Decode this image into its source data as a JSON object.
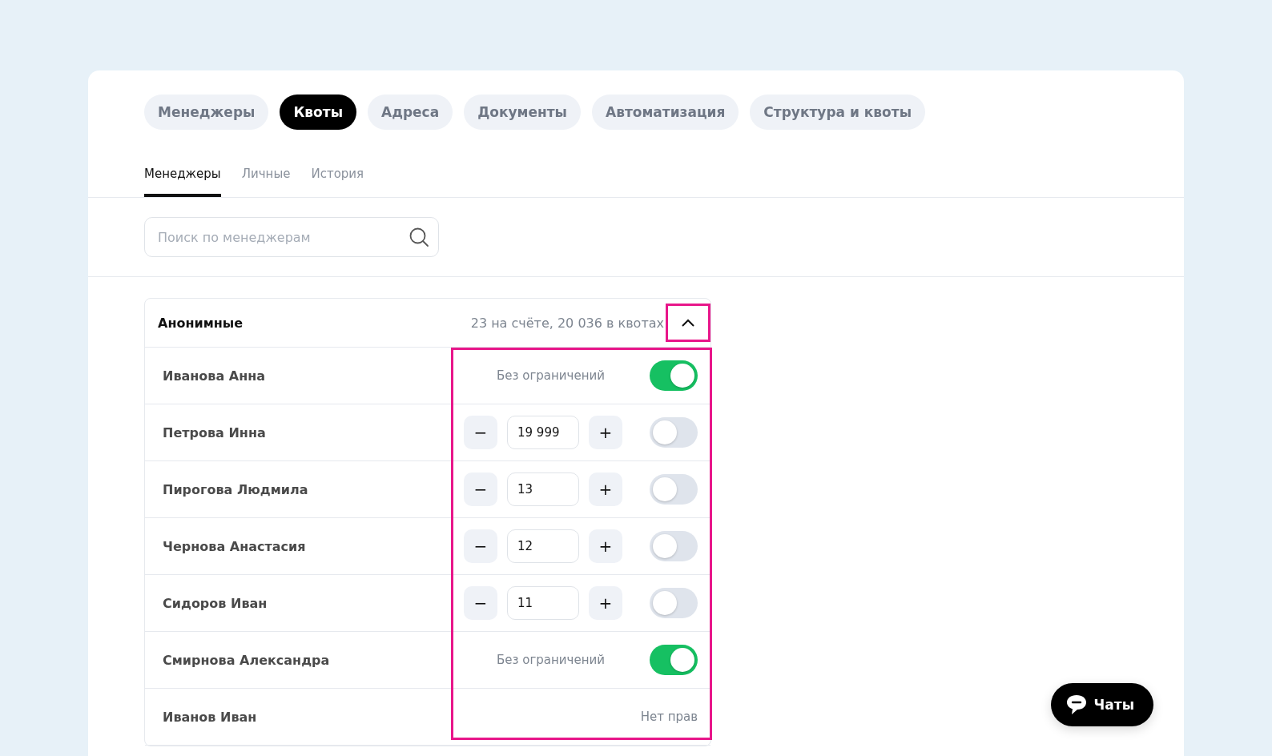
{
  "tabs": [
    {
      "label": "Менеджеры",
      "selected": false
    },
    {
      "label": "Квоты",
      "selected": true
    },
    {
      "label": "Адреса",
      "selected": false
    },
    {
      "label": "Документы",
      "selected": false
    },
    {
      "label": "Автоматизация",
      "selected": false
    },
    {
      "label": "Структура и квоты",
      "selected": false
    }
  ],
  "subtabs": [
    {
      "label": "Менеджеры",
      "selected": true
    },
    {
      "label": "Личные",
      "selected": false
    },
    {
      "label": "История",
      "selected": false
    }
  ],
  "search": {
    "placeholder": "Поиск по менеджерам"
  },
  "group": {
    "title": "Анонимные",
    "summary": "23 на счёте, 20 036 в квотах",
    "expanded": true,
    "rows": [
      {
        "name": "Иванова Анна",
        "kind": "unlimited",
        "text": "Без ограничений",
        "on": true
      },
      {
        "name": "Петрова Инна",
        "kind": "stepper",
        "minus": "−",
        "value": "19 999",
        "plus": "+",
        "on": false
      },
      {
        "name": "Пирогова Людмила",
        "kind": "stepper",
        "minus": "−",
        "value": "13",
        "plus": "+",
        "on": false
      },
      {
        "name": "Чернова Анастасия",
        "kind": "stepper",
        "minus": "−",
        "value": "12",
        "plus": "+",
        "on": false
      },
      {
        "name": "Сидоров Иван",
        "kind": "stepper",
        "minus": "−",
        "value": "11",
        "plus": "+",
        "on": false
      },
      {
        "name": "Смирнова Александра",
        "kind": "unlimited",
        "text": "Без ограничений",
        "on": true
      },
      {
        "name": "Иванов Иван",
        "kind": "none",
        "text": "Нет прав"
      }
    ]
  },
  "chat_button": {
    "label": "Чаты"
  }
}
